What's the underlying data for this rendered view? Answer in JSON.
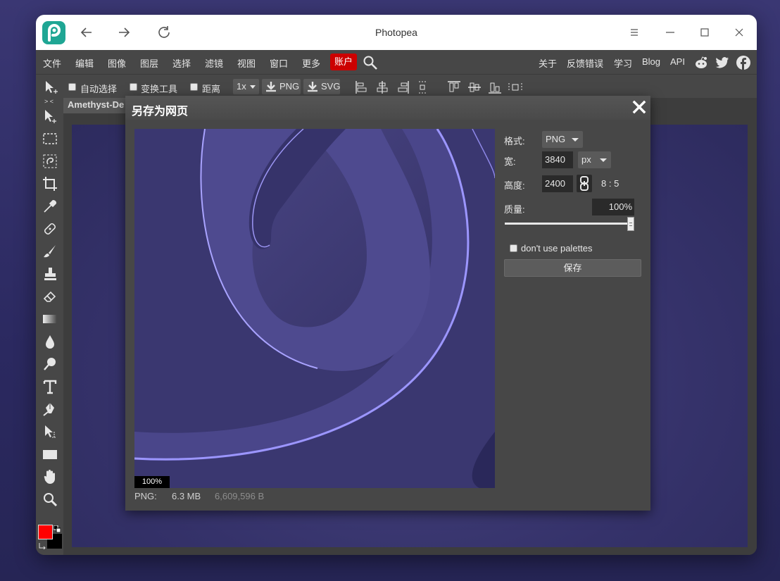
{
  "window": {
    "title": "Photopea"
  },
  "menubar": {
    "items": [
      "文件",
      "编辑",
      "图像",
      "图层",
      "选择",
      "滤镜",
      "视图",
      "窗口",
      "更多"
    ],
    "account": "账户",
    "right_items": [
      "关于",
      "反馈错误",
      "学习",
      "Blog",
      "API"
    ]
  },
  "optionsbar": {
    "auto_select": "自动选择",
    "transform_tools": "变换工具",
    "distance": "距离",
    "scale": "1x",
    "png_label": "PNG",
    "svg_label": "SVG"
  },
  "toolbar": {
    "collapse": "> <"
  },
  "document": {
    "tab_name": "Amethyst-De"
  },
  "dialog": {
    "title": "另存为网页",
    "format_label": "格式:",
    "format_value": "PNG",
    "width_label": "宽:",
    "width_value": "3840",
    "unit_value": "px",
    "height_label": "高度:",
    "height_value": "2400",
    "ratio": "8 : 5",
    "quality_label": "质量:",
    "quality_value": "100%",
    "quality_level": 1.0,
    "palettes_label": "don't use palettes",
    "palettes_checked": false,
    "save_label": "保存",
    "zoom": "100%",
    "info_format": "PNG:",
    "info_size": "6.3 MB",
    "info_bytes": "6,609,596 B"
  },
  "colors": {
    "accent_account": "#cc0000",
    "foreground": "#ff0000",
    "background": "#000000",
    "logo": "#1fa694"
  }
}
